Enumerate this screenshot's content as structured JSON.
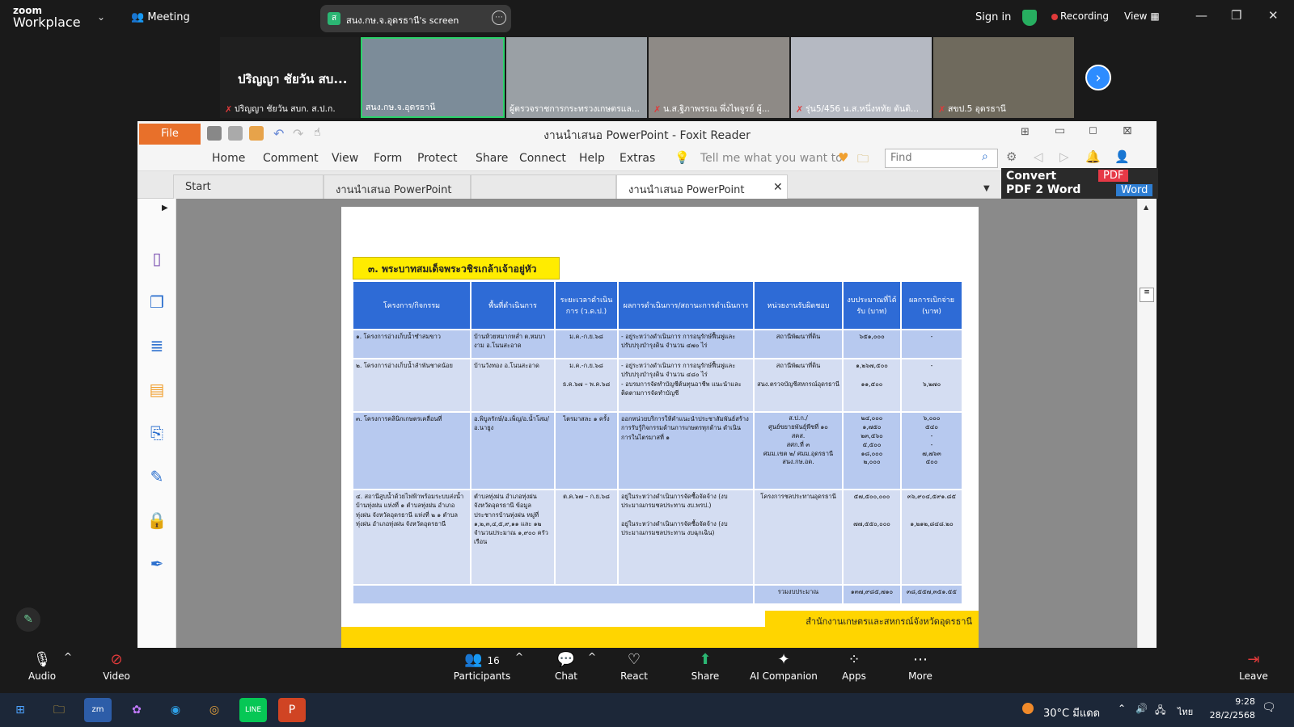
{
  "zoom": {
    "logo_line1": "zoom",
    "logo_line2": "Workplace",
    "meeting_label": "Meeting",
    "share_badge": "ส",
    "share_label": "สนง.กษ.จ.อุดรธานี's screen",
    "sign_in": "Sign in",
    "recording": "Recording",
    "view": "View",
    "participants_count": "16",
    "toolbar": {
      "audio": "Audio",
      "video": "Video",
      "participants": "Participants",
      "chat": "Chat",
      "react": "React",
      "share": "Share",
      "ai": "AI Companion",
      "apps": "Apps",
      "more": "More",
      "leave": "Leave"
    }
  },
  "tiles": [
    {
      "name": "ปริญญา ชัยวัน สบ...",
      "caption": "ปริญญา ชัยวัน สบก. ส.ป.ก."
    },
    {
      "caption": "สนง.กษ.จ.อุดรธานี"
    },
    {
      "caption": "ผู้ตรวจราชการกระทรวงเกษตรแล..."
    },
    {
      "caption": "น.ส.ฐิภาพรรณ พึ่งไพจูรย์ ผู้..."
    },
    {
      "caption": "รุ่น5/456 น.ส.หนึ่งหทัย ตันติ..."
    },
    {
      "caption": "สขป.5 อุดรธานี"
    }
  ],
  "foxit": {
    "title": "งานนำเสนอ PowerPoint - Foxit Reader",
    "menu": [
      "Home",
      "Comment",
      "View",
      "Form",
      "Protect",
      "Share",
      "Connect",
      "Help",
      "Extras"
    ],
    "file": "File",
    "tell_me": "Tell me what you want to",
    "find_placeholder": "Find",
    "tabs": [
      "Start",
      "งานนำเสนอ PowerPoint",
      "",
      "งานนำเสนอ PowerPoint"
    ],
    "promo_line1": "Convert",
    "promo_line2": "PDF 2 Word",
    "promo_pdf": "PDF",
    "promo_word": "Word"
  },
  "doc": {
    "section_title": "๓. พระบาทสมเด็จพระวชิรเกล้าเจ้าอยู่หัว",
    "headers": [
      "โครงการ/กิจกรรม",
      "พื้นที่ดำเนินการ",
      "ระยะเวลาดำเนินการ (ว.ด.ป.)",
      "ผลการดำเนินการ/สถานะการดำเนินการ",
      "หน่วยงานรับผิดชอบ",
      "งบประมาณที่ได้รับ (บาท)",
      "ผลการเบิกจ่าย (บาท)"
    ],
    "rows": [
      [
        "๑. โครงการอ่างเก็บน้ำซำสมขาว",
        "บ้านห้วยหมากหล่ำ ต.หมบางาม อ.โนนสะอาด",
        "ม.ค.-ก.ย.๖๘",
        "- อยู่ระหว่างดำเนินการ การอนุรักษ์ฟื้นฟูและปรับปรุงบำรุงดิน จำนวน ๔๗๐ ไร่",
        "สถานีพัฒนาที่ดิน",
        "๖๕๑,๐๐๐",
        "-"
      ],
      [
        "๒. โครงการอ่างเก็บน้ำลำพันชาดน้อย",
        "บ้านวังทอง อ.โนนสะอาด",
        "ม.ค.-ก.ย.๖๘\n\nธ.ค.๖๗ – พ.ค.๖๘",
        "- อยู่ระหว่างดำเนินการ การอนุรักษ์ฟื้นฟูและปรับปรุงบำรุงดิน จำนวน ๔๘๐ ไร่\n- อบรมการจัดทำบัญชีต้นทุนอาชีพ แนะนำและติดตามการจัดทำบัญชี",
        "สถานีพัฒนาที่ดิน\n\nสนง.ตรวจบัญชีสหกรณ์อุดรธานี",
        "๑,๒๖๗,๕๐๐\n\n๑๑,๕๐๐",
        "-\n\n๖,๒๗๐"
      ],
      [
        "๓. โครงการคลินิกเกษตรเคลื่อนที่",
        "อ.พิบูลรักษ์/อ.เพ็ญ/อ.น้ำโสม/อ.นายูง",
        "ไตรมาสละ ๑ ครั้ง",
        "ออกหน่วยบริการให้คำแนะนำประชาสัมพันธ์สร้างการรับรู้กิจกรรมด้านการเกษตรทุกด้าน ดำเนินการในไตรมาสที่ ๑",
        "ส.ป.ก./\nศูนย์ขยายพันธุ์พืชที่ ๑๐\nสคส.\nสศก.ที่ ๓\nศมม.เขต ๒/ ศมม.อุดรธานี\nสนง.กษ.อด.",
        "๒๔,๐๐๐\n๑,๗๕๐\n๒๓,๕๖๐\n๕,๕๐๐\n๑๘,๐๐๐\n๒,๐๐๐",
        "๖,๐๐๐\n๕๔๐\n-\n-\n๗,๗๖๓\n๕๐๐"
      ],
      [
        "๔. สถานีสูบน้ำด้วยไฟฟ้าพร้อมระบบส่งน้ำบ้านทุ่งฝน แห่งที่ ๑ ตำบลทุ่งฝน อำเภอทุ่งฝน จังหวัดอุดรธานี แห่งที่ ๒ ๑ ตำบลทุ่งฝน อำเภอทุ่งฝน จังหวัดอุดรธานี",
        "ตำบลทุ่งฝน อำเภอทุ่งฝน จังหวัดอุดรธานี ข้อมูลประชากรบ้านทุ่งฝน หมู่ที่ ๑,๒,๓,๔,๕,๙,๑๑ และ ๑๒ จำนวนประมาณ ๑,๙๐๐ ครัวเรือน",
        "ต.ค.๖๗ – ก.ย.๖๘",
        "อยู่ในระหว่างดำเนินการจัดซื้อจัดจ้าง (งบประมาณกรมชลประทาน งบ.พรป.)\n\nอยู่ในระหว่างดำเนินการจัดซื้อจัดจ้าง (งบประมาณกรมชลประทาน งบฉุกเฉิน)",
        "โครงการชลประทานอุดรธานี",
        "๕๗,๕๐๐,๐๐๐\n\n\n๗๗,๕๕๐,๐๐๐",
        "๓๖,๙๐๔,๕๙๑.๘๕\n\n\n๑,๒๑๒,๘๔๘.๒๐"
      ]
    ],
    "total_label": "รวมงบประมาณ",
    "total_budget": "๑๓๗,๙๘๕,๗๑๐",
    "total_spent": "๓๘,๕๕๗,๓๕๑.๕๕",
    "footer": "สำนักงานเกษตรและสหกรณ์จังหวัดอุดรธานี"
  },
  "taskbar": {
    "temp": "30°C มีแดด",
    "lang": "ไทย",
    "time": "9:28",
    "date": "28/2/2568"
  }
}
